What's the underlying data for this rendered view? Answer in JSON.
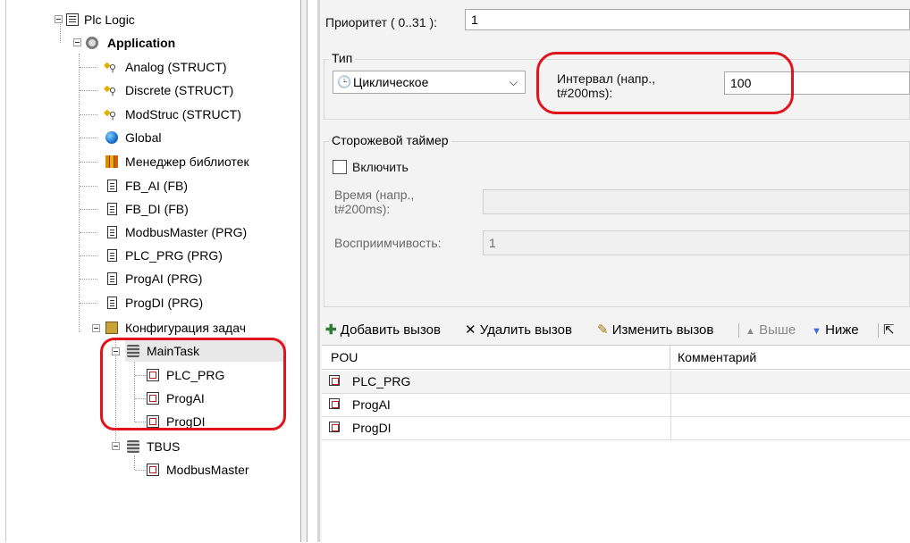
{
  "tree": {
    "root": "Plc Logic",
    "application": "Application",
    "items": [
      {
        "label": "Analog (STRUCT)",
        "icon": "struct-icon"
      },
      {
        "label": "Discrete (STRUCT)",
        "icon": "struct-icon"
      },
      {
        "label": "ModStruc (STRUCT)",
        "icon": "struct-icon"
      },
      {
        "label": "Global",
        "icon": "globe-icon"
      },
      {
        "label": "Менеджер библиотек",
        "icon": "library-icon"
      },
      {
        "label": "FB_AI (FB)",
        "icon": "document-icon"
      },
      {
        "label": "FB_DI (FB)",
        "icon": "document-icon"
      },
      {
        "label": "ModbusMaster (PRG)",
        "icon": "document-icon"
      },
      {
        "label": "PLC_PRG (PRG)",
        "icon": "document-icon"
      },
      {
        "label": "ProgAI (PRG)",
        "icon": "document-icon"
      },
      {
        "label": "ProgDI (PRG)",
        "icon": "document-icon"
      }
    ],
    "task_config": "Конфигурация задач",
    "maintask": "MainTask",
    "maintask_calls": [
      "PLC_PRG",
      "ProgAI",
      "ProgDI"
    ],
    "tbus": "TBUS",
    "tbus_calls": [
      "ModbusMaster"
    ]
  },
  "editor": {
    "priority_label": "Приоритет ( 0..31 ):",
    "priority_value": "1",
    "type_group": "Тип",
    "type_value": "Циклическое",
    "interval_label_1": "Интервал (напр.,",
    "interval_label_2": "t#200ms):",
    "interval_value": "100",
    "watchdog_group": "Сторожевой таймер",
    "enable_label": "Включить",
    "time_label_1": "Время (напр.,",
    "time_label_2": "t#200ms):",
    "sensitivity_label": "Восприимчивость:",
    "sensitivity_value": "1"
  },
  "toolbar": {
    "add_call": "Добавить вызов",
    "remove_call": "Удалить вызов",
    "edit_call": "Изменить вызов",
    "up": "Выше",
    "down": "Ниже"
  },
  "grid": {
    "columns": [
      "POU",
      "Комментарий"
    ],
    "rows": [
      {
        "pou": "PLC_PRG",
        "comment": ""
      },
      {
        "pou": "ProgAI",
        "comment": ""
      },
      {
        "pou": "ProgDI",
        "comment": ""
      }
    ]
  },
  "colors": {
    "annotation": "#e0141a",
    "panel_bg": "#f3f3f3",
    "add_icon": "#2e7d32",
    "arrow_icon": "#3a6fd8"
  }
}
